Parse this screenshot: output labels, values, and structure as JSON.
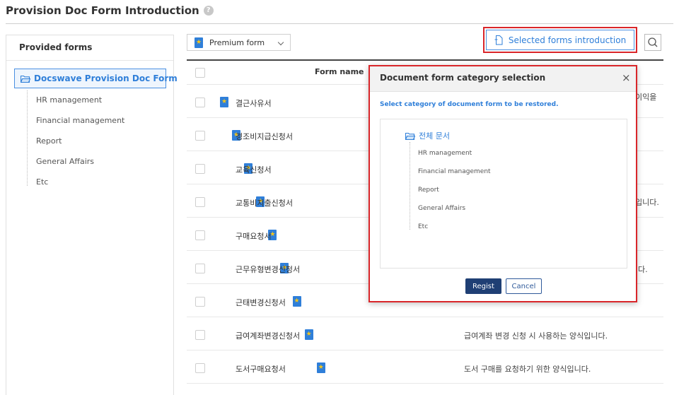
{
  "page": {
    "title": "Provision Doc Form Introduction",
    "help_icon": "?"
  },
  "sidebar": {
    "header": "Provided forms",
    "root": "Docswave Provision Doc Form",
    "items": [
      "HR management",
      "Financial management",
      "Report",
      "General Affairs",
      "Etc"
    ]
  },
  "toolbar": {
    "dropdown_value": "Premium form",
    "selected_button": "Selected forms introduction"
  },
  "table": {
    "header_name": "Form name",
    "rows": [
      {
        "name": "결근사유서",
        "desc": ""
      },
      {
        "name": "경조비지급신청서",
        "desc": ""
      },
      {
        "name": "교육신청서",
        "desc": ""
      },
      {
        "name": "교통비지출신청서",
        "desc": ""
      },
      {
        "name": "구매요청서",
        "desc": ""
      },
      {
        "name": "근무유형변경신청서",
        "desc": ""
      },
      {
        "name": "근태변경신청서",
        "desc": ""
      },
      {
        "name": "급여계좌변경신청서",
        "desc": "급여계좌 변경 신청 시 사용하는 양식입니다."
      },
      {
        "name": "도서구매요청서",
        "desc": "도서 구매를 요청하기 위한 양식입니다."
      }
    ],
    "partial_desc": [
      "이익을 ",
      "입니다.",
      "다."
    ]
  },
  "modal": {
    "title": "Document form category selection",
    "close_icon": "×",
    "subtitle": "Select category of document form to be restored.",
    "root": "전체 문서",
    "items": [
      "HR management",
      "Financial management",
      "Report",
      "General Affairs",
      "Etc"
    ],
    "regist_label": "Regist",
    "cancel_label": "Cancel"
  },
  "colors": {
    "accent": "#2f7fd9",
    "highlight": "#d9262a",
    "primary_button": "#1f3f74"
  }
}
